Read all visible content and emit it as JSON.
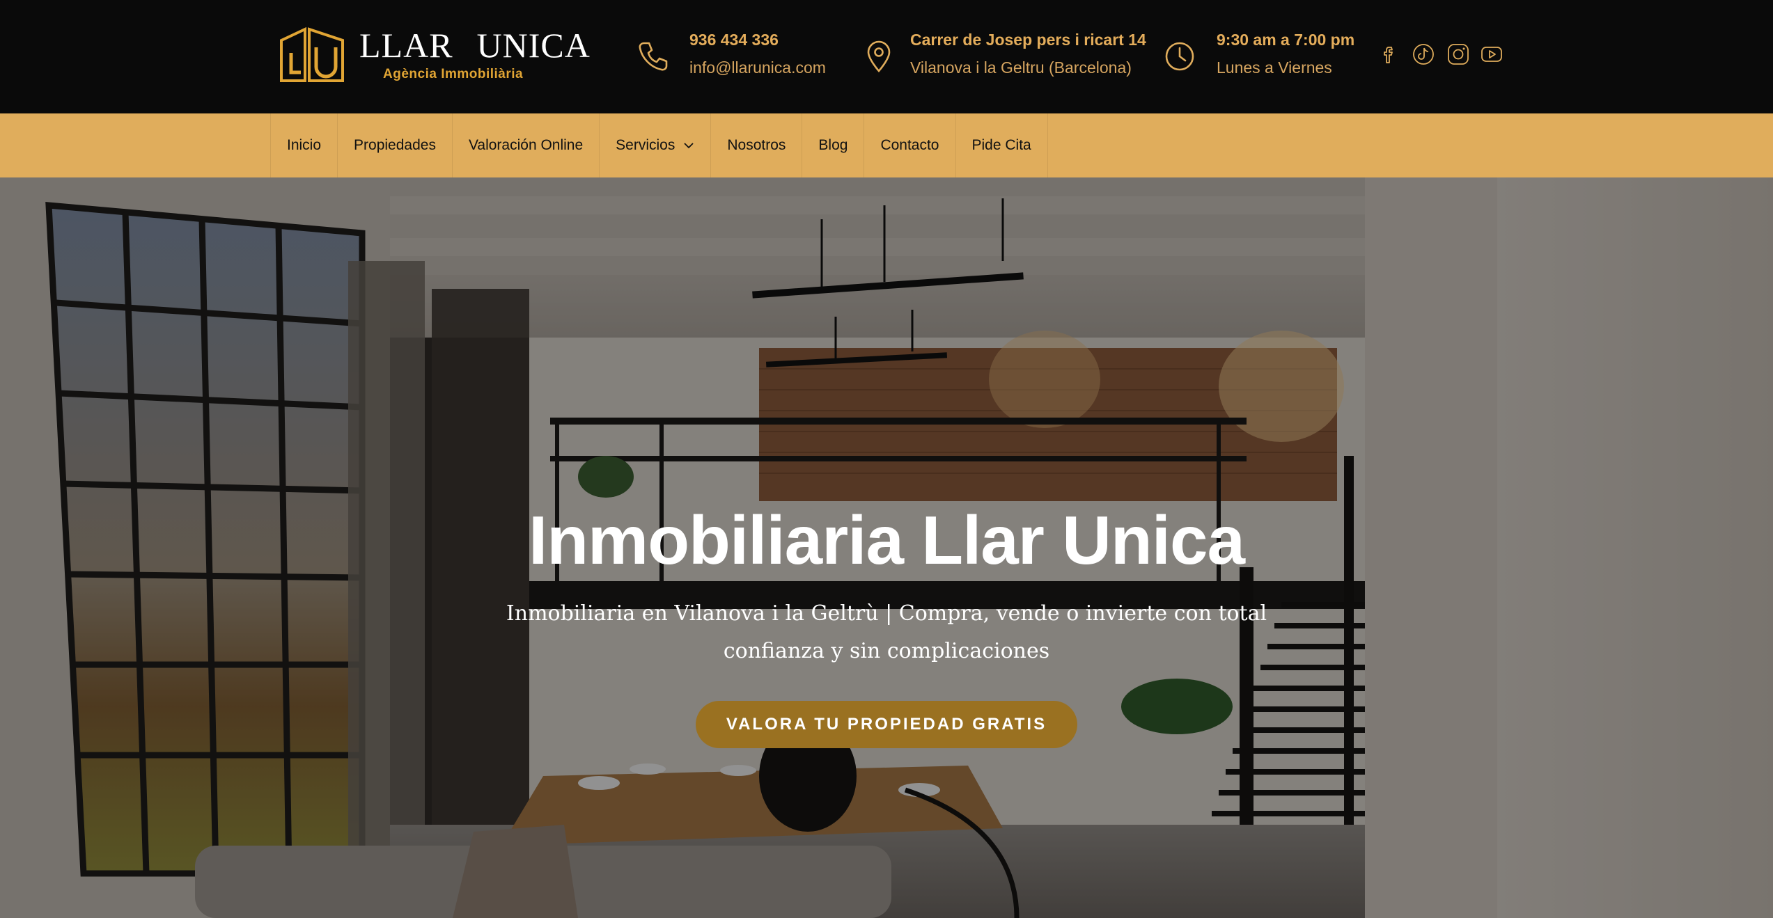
{
  "brand": {
    "name_part1": "LLAR",
    "name_part2": "UNICA",
    "tagline": "Agència Immobiliària",
    "accent_color": "#e0ad5c"
  },
  "contact": {
    "phone": {
      "icon": "phone-icon",
      "line1": "936 434 336",
      "line2": "info@llarunica.com"
    },
    "address": {
      "icon": "map-pin-icon",
      "line1": "Carrer de Josep pers i ricart 14",
      "line2": "Vilanova i la Geltru (Barcelona)"
    },
    "hours": {
      "icon": "clock-icon",
      "line1": "9:30 am a 7:00 pm",
      "line2": "Lunes a Viernes"
    }
  },
  "social": [
    "facebook-icon",
    "tiktok-icon",
    "instagram-icon",
    "youtube-icon"
  ],
  "nav": {
    "items": [
      {
        "label": "Inicio"
      },
      {
        "label": "Propiedades"
      },
      {
        "label": "Valoración Online"
      },
      {
        "label": "Servicios",
        "has_dropdown": true
      },
      {
        "label": "Nosotros"
      },
      {
        "label": "Blog"
      },
      {
        "label": "Contacto"
      },
      {
        "label": "Pide Cita"
      }
    ]
  },
  "hero": {
    "title": "Inmobiliaria Llar Unica",
    "subtitle": "Inmobiliaria en Vilanova i la Geltrù | Compra, vende o invierte con total confianza y sin complicaciones",
    "cta_label": "VALORA TU PROPIEDAD GRATIS",
    "cta_color": "#9a7121"
  }
}
